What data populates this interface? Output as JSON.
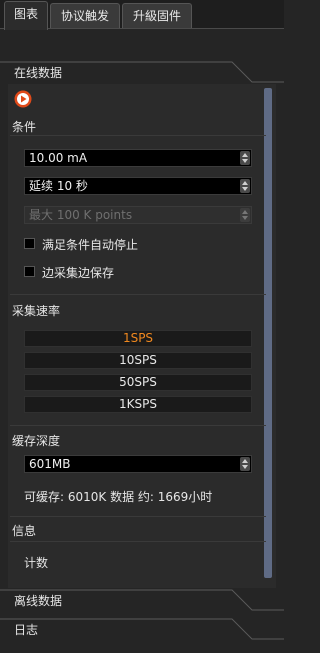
{
  "tabs": [
    {
      "label": "图表",
      "active": true
    },
    {
      "label": "协议触发",
      "active": false
    },
    {
      "label": "升級固件",
      "active": false
    }
  ],
  "online": {
    "header": "在线数据",
    "play_icon": "record-play-icon",
    "accent_color": "#e04a1a",
    "conditions": {
      "title": "条件",
      "current_value": "10.00 mA",
      "duration_value": "延续 10 秒",
      "max_points_value": "最大 100 K points",
      "max_points_enabled": false,
      "auto_stop_label": "满足条件自动停止",
      "auto_stop_checked": false,
      "save_while_label": "边采集边保存",
      "save_while_checked": false
    },
    "sample_rate": {
      "title": "采集速率",
      "options": [
        "1SPS",
        "10SPS",
        "50SPS",
        "1KSPS"
      ],
      "selected": "1SPS",
      "selected_color": "#f0881f"
    },
    "buffer": {
      "title": "缓存深度",
      "value": "601MB",
      "info": "可缓存: 6010K 数据 约: 1669小时"
    },
    "info": {
      "title": "信息",
      "count_label": "计数"
    }
  },
  "offline": {
    "header": "离线数据"
  },
  "log": {
    "header": "日志"
  }
}
